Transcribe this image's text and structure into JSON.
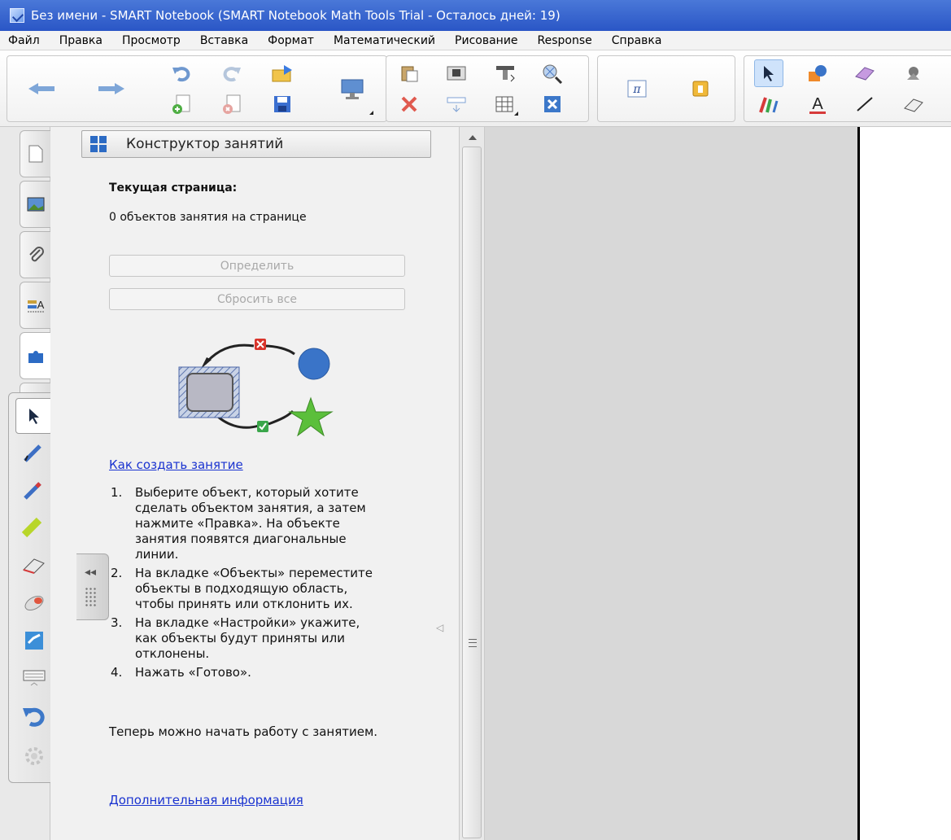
{
  "window": {
    "title": "Без имени - SMART Notebook (SMART Notebook Math Tools Trial - Осталось дней: 19)"
  },
  "menu": [
    "Файл",
    "Правка",
    "Просмотр",
    "Вставка",
    "Формат",
    "Математический",
    "Рисование",
    "Response",
    "Справка"
  ],
  "toolbar": {
    "groups": [
      {
        "icons": [
          "back-arrow-icon",
          "forward-arrow-icon",
          "undo-icon",
          "redo-icon",
          "open-folder-icon",
          "add-page-icon",
          "delete-page-icon",
          "save-icon",
          "screen-display-icon"
        ]
      },
      {
        "icons": [
          "paste-icon",
          "screen-shade-icon",
          "insert-table-icon",
          "fit-page-icon",
          "delete-icon",
          "show-toolbar-icon",
          "table-icon",
          "close-box-icon"
        ]
      },
      {
        "icons": [
          "math-pi-icon",
          "lock-icon"
        ]
      },
      {
        "icons": [
          "select-arrow-icon",
          "shapes-icon",
          "eraser-icon",
          "magic-pen-icon",
          "pens-icon",
          "text-icon",
          "line-icon",
          "erase-board-icon"
        ]
      }
    ]
  },
  "sidebar": {
    "tabs": [
      "page-sorter-icon",
      "gallery-icon",
      "attachments-icon",
      "properties-icon",
      "addons-puzzle-icon"
    ]
  },
  "float_tools": [
    "select-arrow-icon",
    "pen-blue-icon",
    "pen-red-icon",
    "highlighter-icon",
    "eraser-icon",
    "magic-pen-icon",
    "notebook-icon",
    "keyboard-icon",
    "undo-icon",
    "settings-icon"
  ],
  "panel": {
    "header": "Конструктор занятий",
    "current_page_label": "Текущая страница:",
    "objects_count": "0 объектов занятия на странице",
    "define_button": "Определить",
    "reset_button": "Сбросить все",
    "how_to_link": "Как создать занятие",
    "steps": [
      {
        "num": "1.",
        "text": "Выберите объект, который хотите сделать объектом занятия, а затем нажмите «Правка». На объекте занятия появятся диагональные линии."
      },
      {
        "num": "2.",
        "text": "На вкладке «Объекты» переместите объекты в подходящую область, чтобы принять или отклонить их."
      },
      {
        "num": "3.",
        "text": "На вкладке «Настройки» укажите, как объекты будут приняты или отклонены."
      },
      {
        "num": "4.",
        "text": "Нажать «Готово»."
      }
    ],
    "now_text": "Теперь можно начать работу с занятием.",
    "more_info_link": "Дополнительная информация",
    "collapse_label": "◂◂"
  },
  "colors": {
    "titlebar": "#2a56c6",
    "link": "#1a33d0",
    "accent_blue": "#3a74c8",
    "star_green": "#5bbf3b",
    "reject_red": "#d9342b",
    "accept_green": "#3aa64a"
  }
}
